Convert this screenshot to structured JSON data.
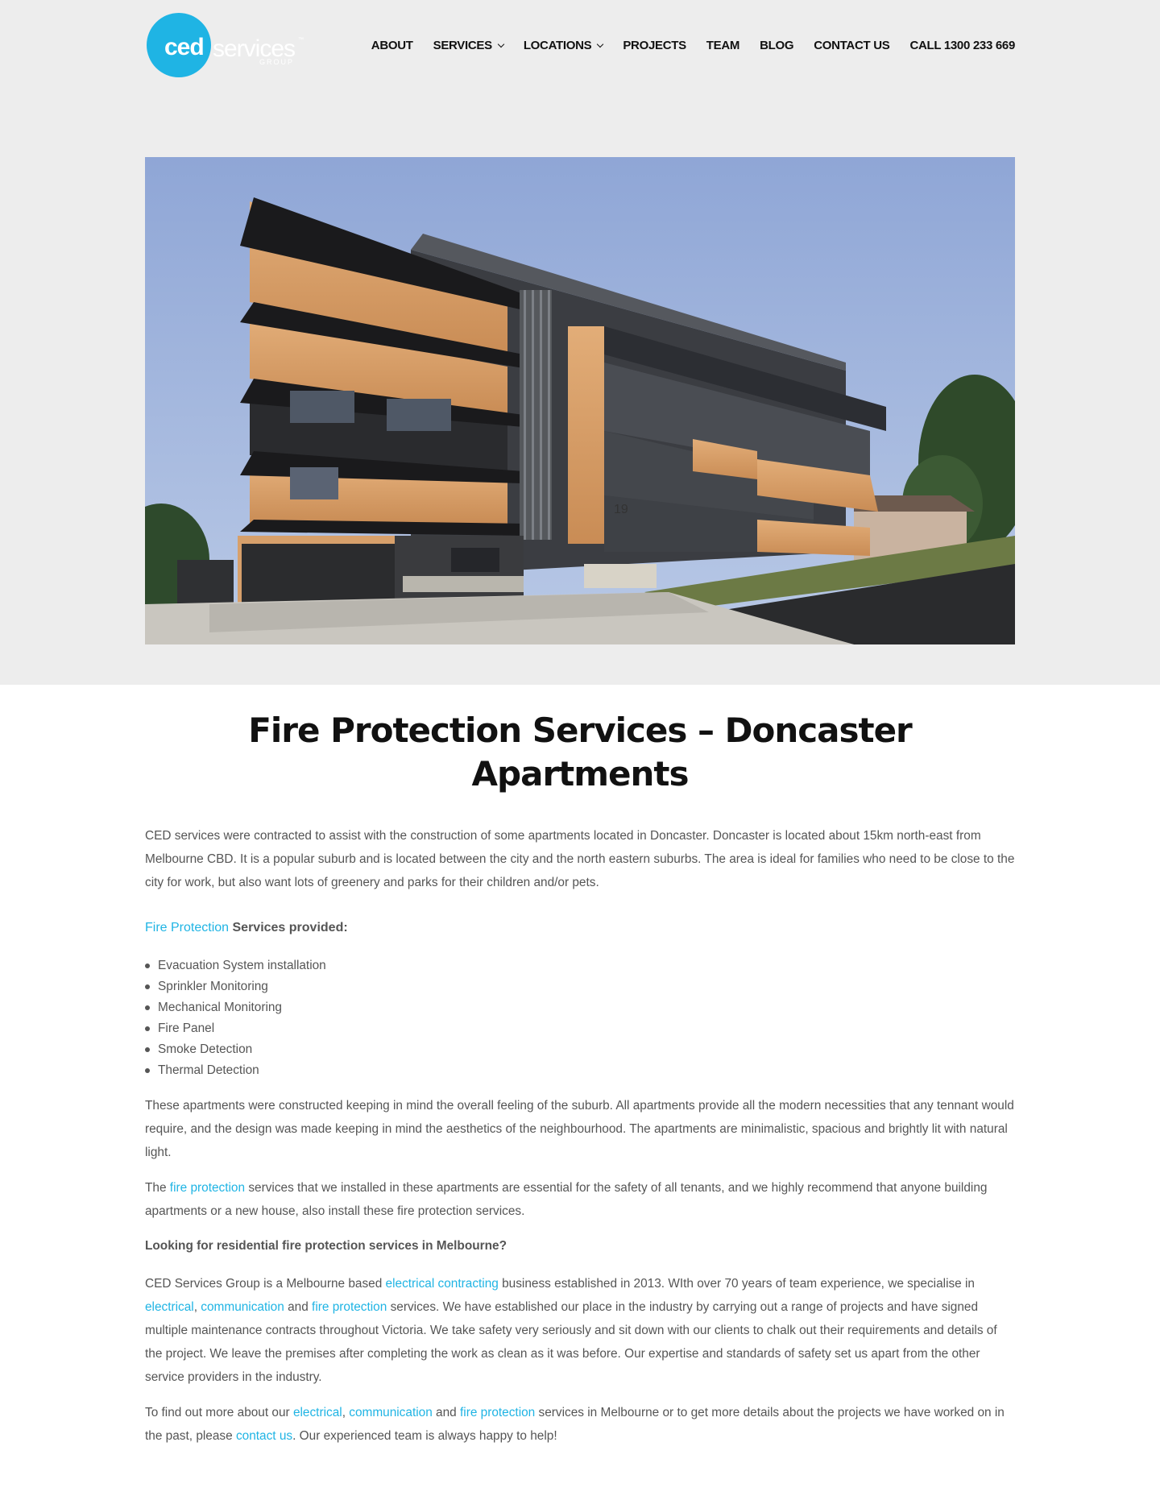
{
  "brand": {
    "logo_main": "ced",
    "logo_services": "services",
    "logo_tm": "™",
    "logo_group": "GROUP",
    "accent_color": "#1fb4e4"
  },
  "nav": {
    "items": [
      {
        "label": "ABOUT",
        "has_dropdown": false
      },
      {
        "label": "SERVICES",
        "has_dropdown": true
      },
      {
        "label": "LOCATIONS",
        "has_dropdown": true
      },
      {
        "label": "PROJECTS",
        "has_dropdown": false
      },
      {
        "label": "TEAM",
        "has_dropdown": false
      },
      {
        "label": "BLOG",
        "has_dropdown": false
      },
      {
        "label": "CONTACT US",
        "has_dropdown": false
      },
      {
        "label": "CALL 1300 233 669",
        "has_dropdown": false
      }
    ]
  },
  "hero": {
    "house_number": "19"
  },
  "page": {
    "title_line1": "Fire Protection Services – Doncaster",
    "title_line2": "Apartments",
    "intro": "CED services were contracted to assist with the construction of some apartments located in Doncaster. Doncaster is located about 15km north-east from Melbourne CBD. It is a popular suburb and is located between the city and the north eastern suburbs. The area is ideal for families who need to be close to the city for work, but also want lots of greenery and parks for their children and/or pets.",
    "services_heading_link": "Fire Protection",
    "services_heading_rest": " Services provided:",
    "services_list": [
      "Evacuation System installation",
      "Sprinkler Monitoring",
      "Mechanical Monitoring",
      "Fire Panel",
      "Smoke Detection",
      "Thermal Detection"
    ],
    "p2": "These apartments were constructed keeping in mind the overall feeling of the suburb. All apartments  provide all the modern necessities that any tennant would require, and the design was made keeping in mind the aesthetics of the neighbourhood. The apartments are minimalistic, spacious and brightly lit with natural light.",
    "p3_a": "The ",
    "p3_link": "fire protection",
    "p3_b": " services that we installed in these apartments are essential for the safety of all tenants, and we highly recommend that anyone building apartments or a new house, also install these fire protection services.",
    "subheading": "Looking for residential fire protection services in Melbourne?",
    "p4_a": "CED Services Group is a Melbourne based ",
    "p4_link1": "electrical contracting",
    "p4_b": " business established in 2013. WIth over 70 years of team experience, we specialise in ",
    "p4_link2": "electrical",
    "p4_c": ", ",
    "p4_link3": "communication",
    "p4_d": " and ",
    "p4_link4": "fire protection",
    "p4_e": " services. We have established our place in the industry by carrying out a range of projects and have signed multiple maintenance contracts throughout Victoria. We take safety very seriously and sit down with our clients to chalk out their requirements and details of the project. We leave the premises after completing the work as clean as it was before. Our expertise and standards of safety set us apart from the other service providers in the industry.",
    "p5_a": "To find out more about our ",
    "p5_link1": "electrical",
    "p5_b": ", ",
    "p5_link2": "communication",
    "p5_c": " and ",
    "p5_link3": "fire protection",
    "p5_d": " services in Melbourne or to get more details about the projects we have worked on in the past, please ",
    "p5_link4": "contact us",
    "p5_e": ". Our experienced team is always happy to help!"
  }
}
